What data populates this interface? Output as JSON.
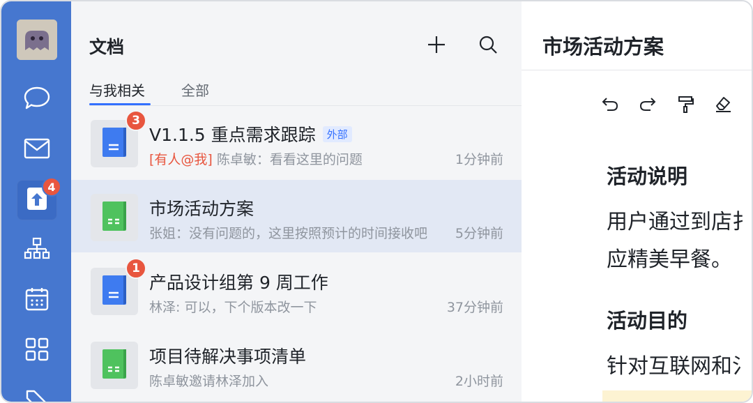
{
  "rail": {
    "items": [
      {
        "name": "chat-icon"
      },
      {
        "name": "mail-icon"
      },
      {
        "name": "docs-icon",
        "badge": "4"
      },
      {
        "name": "org-chart-icon"
      },
      {
        "name": "calendar-icon"
      },
      {
        "name": "apps-grid-icon"
      }
    ]
  },
  "docs": {
    "title": "文档",
    "tabs": [
      "与我相关",
      "全部"
    ],
    "active_tab": "与我相关",
    "items": [
      {
        "name": "V1.1.5 重点需求跟踪",
        "tag": "外部",
        "badge": "3",
        "mention": "[有人@我]",
        "subtitle": "陈卓敏：看看这里的问题",
        "time": "1分钟前",
        "type": "doc"
      },
      {
        "name": "市场活动方案",
        "subtitle": "张姐：没有问题的，这里按照预计的时间接收吧",
        "time": "5分钟前",
        "type": "sheet",
        "selected": true
      },
      {
        "name": "产品设计组第 9 周工作",
        "badge": "1",
        "subtitle": "林泽: 可以，下个版本改一下",
        "time": "37分钟前",
        "type": "doc"
      },
      {
        "name": "项目待解决事项清单",
        "subtitle": "陈卓敏邀请林泽加入",
        "time": "2小时前",
        "type": "sheet"
      }
    ]
  },
  "editor": {
    "title": "市场活动方案",
    "toolbar": [
      "undo-icon",
      "redo-icon",
      "format-painter-icon",
      "eraser-icon"
    ],
    "sections": [
      {
        "heading": "活动说明",
        "lines": [
          "用户通过到店扌",
          "应精美早餐。"
        ]
      },
      {
        "heading": "活动目的",
        "lines": [
          "针对互联网和氵"
        ]
      }
    ]
  },
  "colors": {
    "rail": "#4677cf",
    "accent": "#3370ff",
    "badge": "#e8563f",
    "doc_icon": "#3e7bf0",
    "sheet_icon": "#4fc25e"
  }
}
